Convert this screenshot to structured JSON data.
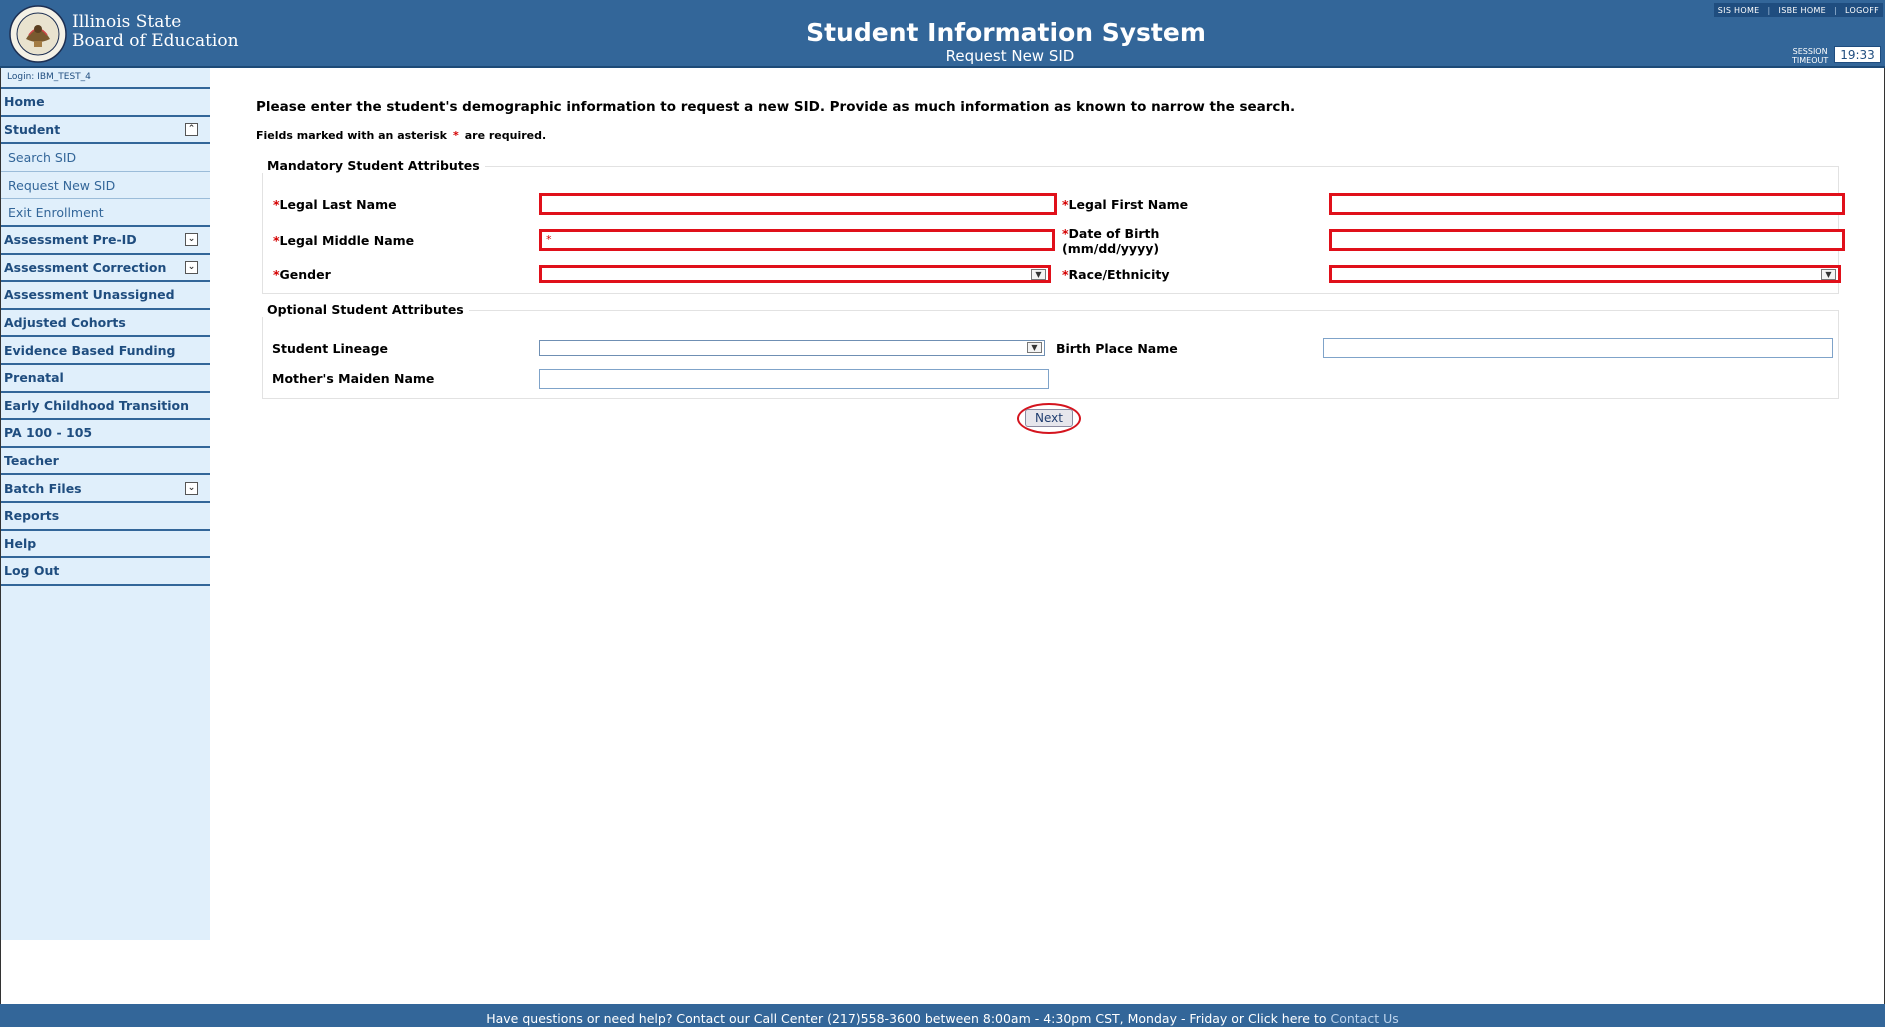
{
  "header": {
    "agency_line1": "Illinois State",
    "agency_line2": "Board of Education",
    "system_title": "Student Information System",
    "page_subtitle": "Request New SID",
    "top_links": [
      "SIS HOME",
      "ISBE HOME",
      "LOGOFF"
    ],
    "session_label_1": "SESSION",
    "session_label_2": "TIMEOUT",
    "session_time": "19:33",
    "colors": {
      "header_bg": "#336699",
      "sidebar_bg": "#e0effb",
      "required": "#e0101a"
    }
  },
  "sidebar": {
    "login": "Login: IBM_TEST_4",
    "home": "Home",
    "student": "Student",
    "student_subitems": [
      "Search SID",
      "Request New SID",
      "Exit Enrollment"
    ],
    "items": [
      {
        "label": "Assessment Pre-ID",
        "toggle": "expand"
      },
      {
        "label": "Assessment Correction",
        "toggle": "expand"
      },
      {
        "label": "Assessment Unassigned"
      },
      {
        "label": "Adjusted Cohorts"
      },
      {
        "label": "Evidence Based Funding"
      },
      {
        "label": "Prenatal"
      },
      {
        "label": "Early Childhood Transition"
      },
      {
        "label": "PA 100 - 105"
      },
      {
        "label": "Teacher"
      },
      {
        "label": "Batch Files",
        "toggle": "expand"
      },
      {
        "label": "Reports"
      },
      {
        "label": "Help"
      },
      {
        "label": "Log Out"
      }
    ]
  },
  "main": {
    "intro": "Please enter the student's demographic information to request a new SID. Provide as much information as known to narrow the search.",
    "required_note_before": "Fields marked with an asterisk",
    "required_note_asterisk": "*",
    "required_note_after": "are required.",
    "mandatory": {
      "legend": "Mandatory Student Attributes",
      "asterisk": "*",
      "last_name_label": "Legal Last Name",
      "first_name_label": "Legal First Name",
      "middle_name_label": "Legal Middle Name",
      "dob_label_line1": "Date of Birth",
      "dob_label_line2": "(mm/dd/yyyy)",
      "gender_label": "Gender",
      "race_label": "Race/Ethnicity",
      "middle_name_value": "*"
    },
    "optional": {
      "legend": "Optional Student Attributes",
      "lineage_label": "Student Lineage",
      "birth_place_label": "Birth Place Name",
      "maiden_label": "Mother's Maiden Name"
    },
    "next_label": "Next"
  },
  "footer": {
    "text": "Have questions or need help? Contact our Call Center (217)558-3600 between 8:00am - 4:30pm CST, Monday - Friday or Click here to",
    "link": "Contact Us"
  }
}
